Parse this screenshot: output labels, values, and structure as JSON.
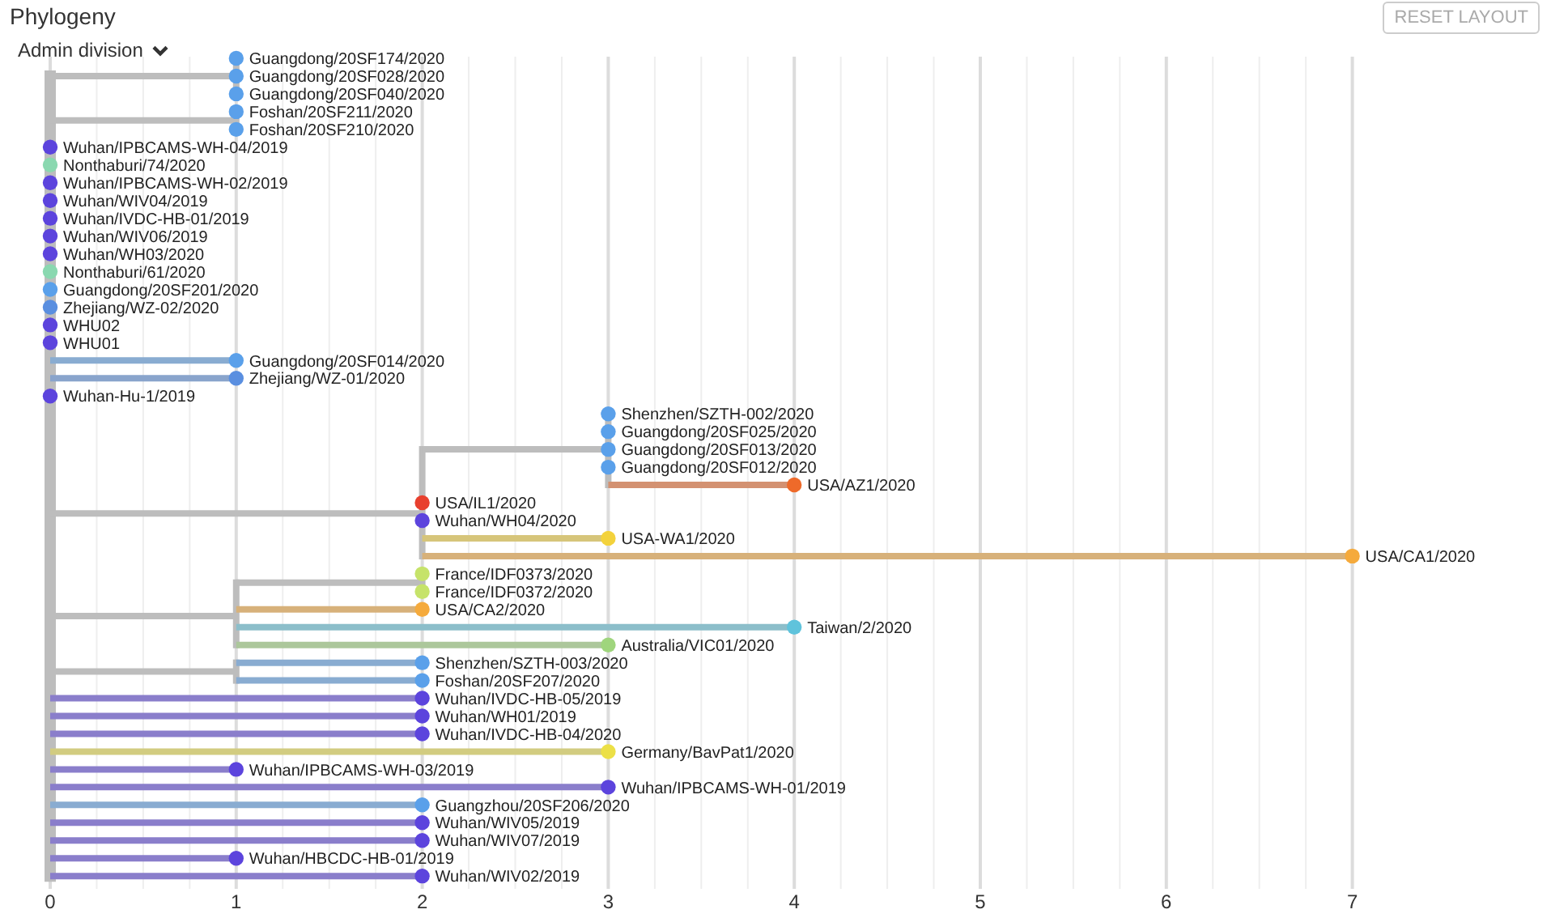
{
  "header": {
    "title": "Phylogeny",
    "reset_button": "RESET LAYOUT",
    "color_by": "Admin division"
  },
  "tree": {
    "axis_ticks": [
      "0",
      "1",
      "2",
      "3",
      "4",
      "5",
      "6",
      "7"
    ],
    "root": {
      "children": [
        {
          "children": [
            {
              "name": "Guangdong/20SF174/2020",
              "color": "#5aa0ea"
            },
            {
              "name": "Guangdong/20SF028/2020",
              "color": "#5aa0ea"
            },
            {
              "name": "Guangdong/20SF040/2020",
              "color": "#5aa0ea"
            }
          ]
        },
        {
          "children": [
            {
              "name": "Foshan/20SF211/2020",
              "color": "#5aa0ea"
            },
            {
              "name": "Foshan/20SF210/2020",
              "color": "#5aa0ea"
            }
          ]
        },
        {
          "name": "Wuhan/IPBCAMS-WH-04/2019",
          "color": "#5c44dd"
        },
        {
          "name": "Nonthaburi/74/2020",
          "color": "#8ad8b0"
        },
        {
          "name": "Wuhan/IPBCAMS-WH-02/2019",
          "color": "#5c44dd"
        },
        {
          "name": "Wuhan/WIV04/2019",
          "color": "#5c44dd"
        },
        {
          "name": "Wuhan/IVDC-HB-01/2019",
          "color": "#5c44dd"
        },
        {
          "name": "Wuhan/WIV06/2019",
          "color": "#5c44dd"
        },
        {
          "name": "Wuhan/WH03/2020",
          "color": "#5c44dd"
        },
        {
          "name": "Nonthaburi/61/2020",
          "color": "#8ad8b0"
        },
        {
          "name": "Guangdong/20SF201/2020",
          "color": "#5aa0ea"
        },
        {
          "name": "Zhejiang/WZ-02/2020",
          "color": "#5a8fe0"
        },
        {
          "name": "WHU02",
          "color": "#5c44dd"
        },
        {
          "name": "WHU01",
          "color": "#5c44dd"
        },
        {
          "name": "Guangdong/20SF014/2020",
          "color": "#5aa0ea"
        },
        {
          "name": "Zhejiang/WZ-01/2020",
          "color": "#5a8fe0"
        },
        {
          "name": "Wuhan-Hu-1/2019",
          "color": "#5c44dd"
        },
        {
          "children": [
            {
              "children": [
                {
                  "name": "Shenzhen/SZTH-002/2020",
                  "color": "#5aa0ea"
                },
                {
                  "name": "Guangdong/20SF025/2020",
                  "color": "#5aa0ea"
                },
                {
                  "name": "Guangdong/20SF013/2020",
                  "color": "#5aa0ea"
                },
                {
                  "name": "Guangdong/20SF012/2020",
                  "color": "#5aa0ea"
                },
                {
                  "name": "USA/AZ1/2020",
                  "color": "#ee6a2a"
                }
              ]
            },
            {
              "name": "USA/IL1/2020",
              "color": "#e8402e"
            },
            {
              "name": "Wuhan/WH04/2020",
              "color": "#5c44dd"
            },
            {
              "name": "USA-WA1/2020",
              "color": "#f3d23c"
            },
            {
              "name": "USA/CA1/2020",
              "color": "#f5aa3c"
            }
          ]
        },
        {
          "children": [
            {
              "children": [
                {
                  "name": "France/IDF0373/2020",
                  "color": "#c6e36a"
                },
                {
                  "name": "France/IDF0372/2020",
                  "color": "#c6e36a"
                }
              ]
            },
            {
              "name": "USA/CA2/2020",
              "color": "#f5aa3c"
            },
            {
              "name": "Taiwan/2/2020",
              "color": "#5fc3dc"
            },
            {
              "name": "Australia/VIC01/2020",
              "color": "#9fd57d"
            }
          ]
        },
        {
          "children": [
            {
              "name": "Shenzhen/SZTH-003/2020",
              "color": "#5aa0ea"
            },
            {
              "name": "Foshan/20SF207/2020",
              "color": "#5aa0ea"
            }
          ]
        },
        {
          "name": "Wuhan/IVDC-HB-05/2019",
          "color": "#5c44dd"
        },
        {
          "name": "Wuhan/WH01/2019",
          "color": "#5c44dd"
        },
        {
          "name": "Wuhan/IVDC-HB-04/2020",
          "color": "#5c44dd"
        },
        {
          "name": "Germany/BavPat1/2020",
          "color": "#ece047"
        },
        {
          "name": "Wuhan/IPBCAMS-WH-03/2019",
          "color": "#5c44dd"
        },
        {
          "name": "Wuhan/IPBCAMS-WH-01/2019",
          "color": "#5c44dd"
        },
        {
          "name": "Guangzhou/20SF206/2020",
          "color": "#5aa0ea"
        },
        {
          "name": "Wuhan/WIV05/2019",
          "color": "#5c44dd"
        },
        {
          "name": "Wuhan/WIV07/2019",
          "color": "#5c44dd"
        },
        {
          "name": "Wuhan/HBCDC-HB-01/2019",
          "color": "#5c44dd"
        },
        {
          "name": "Wuhan/WIV02/2019",
          "color": "#5c44dd"
        }
      ]
    }
  }
}
